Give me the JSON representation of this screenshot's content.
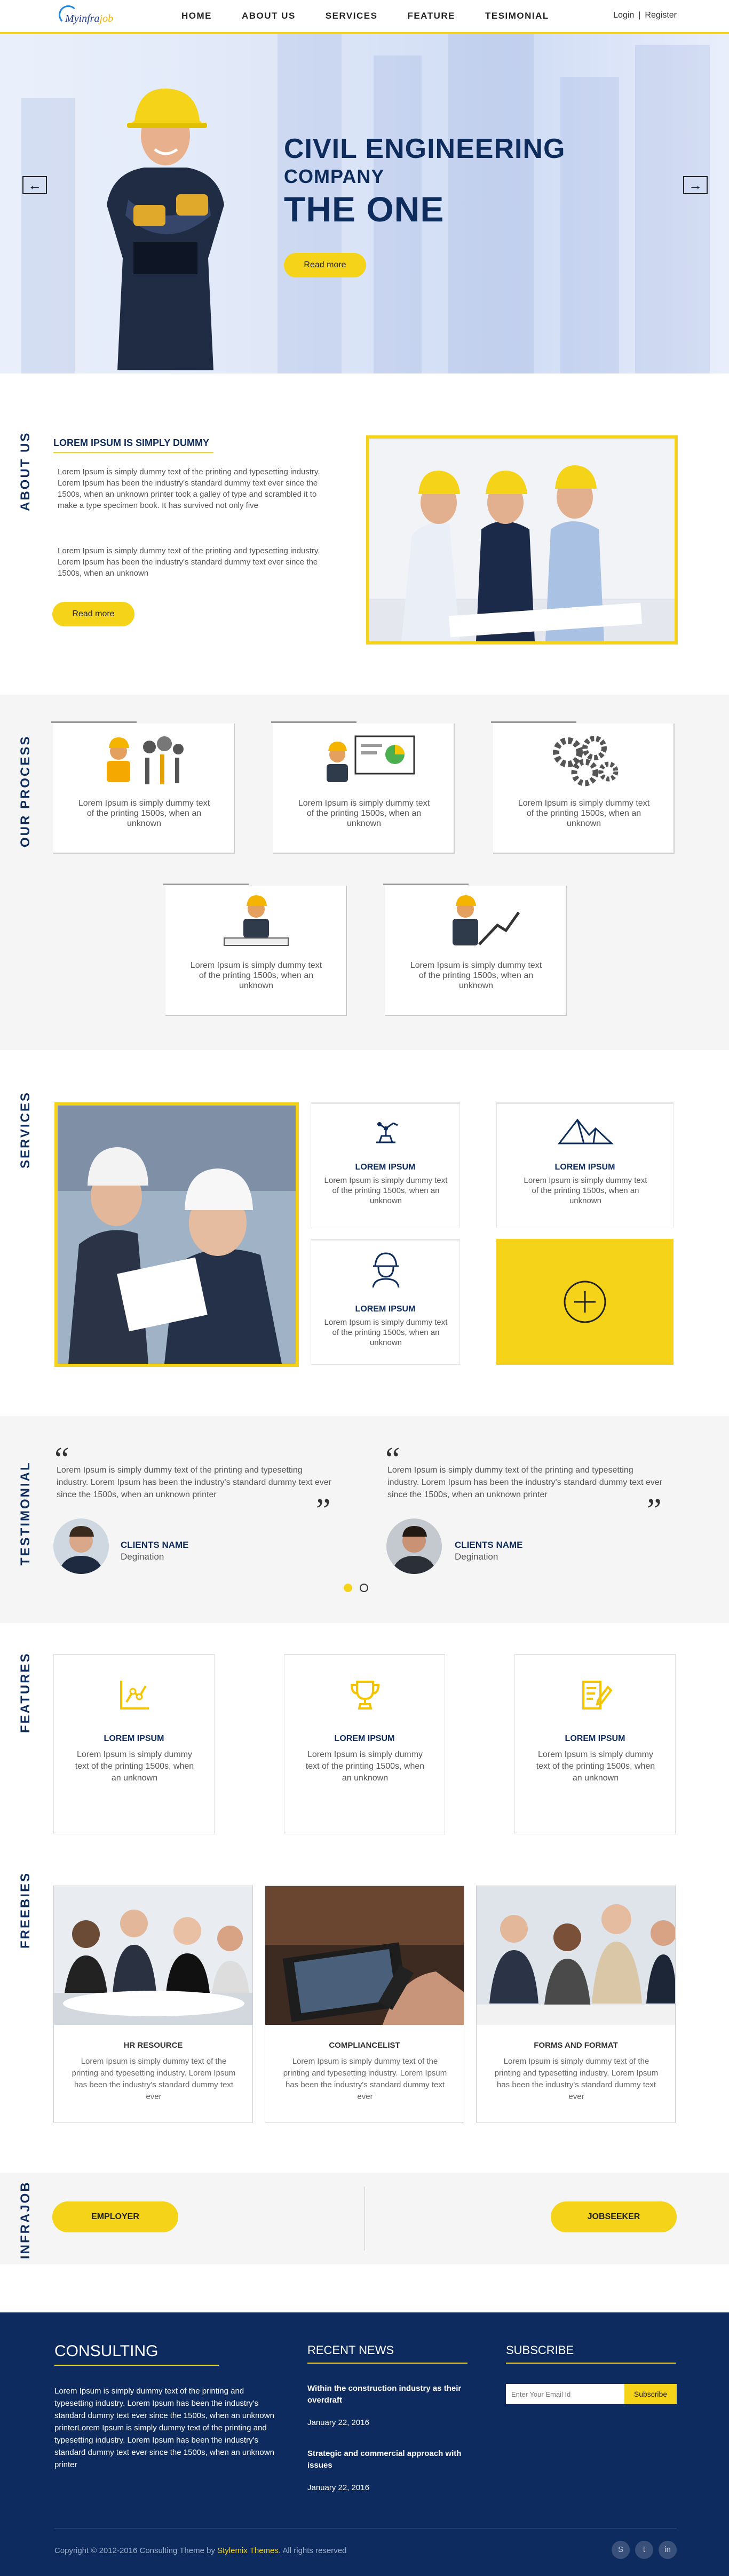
{
  "brand": {
    "logo_text_a": "Myinfra",
    "logo_text_b": "job"
  },
  "nav": {
    "items": [
      "HOME",
      "ABOUT US",
      "SERVICES",
      "FEATURE",
      "TESIMONIAL"
    ],
    "login": "Login",
    "separator": "|",
    "register": "Register"
  },
  "hero": {
    "line1": "CIVIL ENGINEERING",
    "line2": "COMPANY",
    "line3": "THE ONE",
    "button": "Read more",
    "prev_icon": "arrow-left-icon",
    "next_icon": "arrow-right-icon"
  },
  "about": {
    "label": "ABOUT US",
    "heading": "LOREM IPSUM IS SIMPLY DUMMY",
    "p1": "Lorem Ipsum is simply dummy text of the printing and typesetting industry. Lorem Ipsum has been the industry's standard dummy text ever since the 1500s, when an unknown printer took a galley of type and scrambled it to make a type specimen book. It has survived not only five",
    "p2": "Lorem Ipsum is simply dummy text of the printing and typesetting industry. Lorem Ipsum has been the industry's standard dummy text ever since the 1500s, when an unknown",
    "button": "Read more"
  },
  "process": {
    "label": "OUR PROCESS",
    "cards": [
      {
        "icon": "worker-tools-icon",
        "text": "Lorem Ipsum is simply dummy text of the printing  1500s, when an unknown"
      },
      {
        "icon": "presentation-icon",
        "text": "Lorem Ipsum is simply dummy text of the printing  1500s, when an unknown"
      },
      {
        "icon": "gears-icon",
        "text": "Lorem Ipsum is simply dummy text of the printing  1500s, when an unknown"
      },
      {
        "icon": "engineer-desk-icon",
        "text": "Lorem Ipsum is simply dummy text of the printing  1500s, when an unknown"
      },
      {
        "icon": "growth-chart-icon",
        "text": "Lorem Ipsum is simply dummy text of the printing  1500s, when an unknown"
      }
    ]
  },
  "services": {
    "label": "SERVICES",
    "cards": [
      {
        "icon": "robot-arm-icon",
        "title": "LOREM IPSUM",
        "text": "Lorem Ipsum is simply dummy text of the printing  1500s, when an unknown"
      },
      {
        "icon": "mountain-icon",
        "title": "LOREM IPSUM",
        "text": "Lorem Ipsum is simply dummy text of the printing  1500s, when an unknown"
      },
      {
        "icon": "hardhat-worker-icon",
        "title": "LOREM IPSUM",
        "text": "Lorem Ipsum is simply dummy text of the printing  1500s, when an unknown"
      }
    ],
    "more_icon": "plus-circle-icon"
  },
  "testimonial": {
    "label": "TESTIMONIAL",
    "items": [
      {
        "text": "Lorem Ipsum is simply dummy text of the printing and typesetting industry. Lorem Ipsum has been the industry's standard dummy text ever since the 1500s, when an unknown printer",
        "name": "CLIENTS NAME",
        "role": "Degination"
      },
      {
        "text": "Lorem Ipsum is simply dummy text of the printing and typesetting industry. Lorem Ipsum has been the industry's standard dummy text ever since the 1500s, when an unknown printer",
        "name": "CLIENTS NAME",
        "role": "Degination"
      }
    ]
  },
  "features": {
    "label": "FEATURES",
    "cards": [
      {
        "icon": "graph-icon",
        "title": "LOREM IPSUM",
        "text": "Lorem Ipsum is simply dummy text of the printing  1500s, when an unknown"
      },
      {
        "icon": "trophy-icon",
        "title": "LOREM IPSUM",
        "text": "Lorem Ipsum is simply dummy text of the printing  1500s, when an unknown"
      },
      {
        "icon": "edit-note-icon",
        "title": "LOREM IPSUM",
        "text": "Lorem Ipsum is simply dummy text of the printing  1500s, when an unknown"
      }
    ]
  },
  "freebies": {
    "label": "FREEBIES",
    "cards": [
      {
        "title": "HR RESOURCE",
        "text": "Lorem Ipsum is simply dummy text of the printing and typesetting industry. Lorem Ipsum has been the industry's standard dummy text ever"
      },
      {
        "title": "COMPLIANCELIST",
        "text": "Lorem Ipsum is simply dummy text of the printing and typesetting industry. Lorem Ipsum has been the industry's standard dummy text ever"
      },
      {
        "title": "FORMS AND FORMAT",
        "text": "Lorem Ipsum is simply dummy text of the printing and typesetting industry. Lorem Ipsum has been the industry's standard dummy text ever"
      }
    ]
  },
  "infrajob": {
    "label": "INFRAJOB",
    "employer": "EMPLOYER",
    "jobseeker": "JOBSEEKER"
  },
  "footer": {
    "consulting_title": "CONSULTING",
    "consulting_text": "Lorem Ipsum is simply dummy text of the printing and typesetting industry. Lorem Ipsum has been the industry's standard dummy text ever since the 1500s, when an unknown printerLorem Ipsum is simply dummy text of the printing and typesetting industry. Lorem Ipsum has been the industry's standard dummy text ever since the 1500s, when an unknown printer",
    "news_title": "RECENT NEWS",
    "news": [
      {
        "title": "Within the construction industry as their overdraft",
        "date": "January 22, 2016"
      },
      {
        "title": "Strategic and commercial approach with issues",
        "date": "January 22, 2016"
      }
    ],
    "subscribe_title": "SUBSCRIBE",
    "email_placeholder": "Enter Your Email Id",
    "subscribe_button": "Subscribe",
    "copyright_a": "Copyright © 2012-2016 Consulting Theme by ",
    "copyright_link": "Stylemix Themes",
    "copyright_b": ". All rights reserved",
    "social": [
      {
        "icon": "skype-icon",
        "glyph": "S"
      },
      {
        "icon": "twitter-icon",
        "glyph": "t"
      },
      {
        "icon": "linkedin-icon",
        "glyph": "in"
      }
    ]
  },
  "colors": {
    "accent": "#f4d319",
    "navy": "#0d2c5c",
    "footer_bg": "#0d2b5e"
  }
}
